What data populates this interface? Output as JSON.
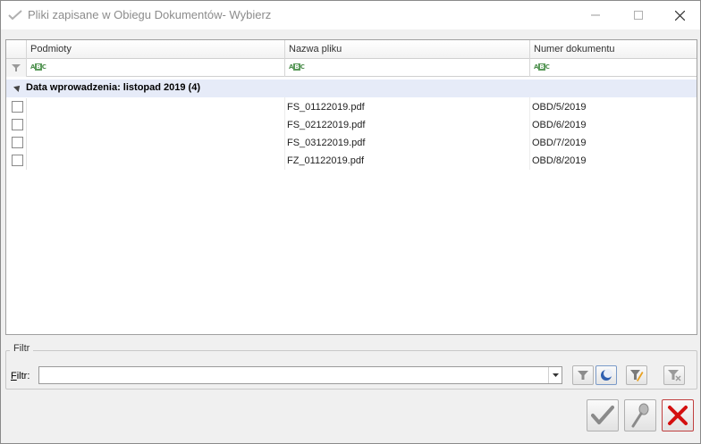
{
  "window": {
    "title": "Pliki zapisane w Obiegu Dokumentów- Wybierz"
  },
  "grid": {
    "columns": [
      "Podmioty",
      "Nazwa pliku",
      "Numer dokumentu"
    ],
    "filter_hint": "ABC",
    "group": {
      "label": "Data wprowadzenia: listopad 2019 (4)"
    },
    "rows": [
      {
        "podmioty": "",
        "nazwa": "FS_01122019.pdf",
        "numer": "OBD/5/2019"
      },
      {
        "podmioty": "",
        "nazwa": "FS_02122019.pdf",
        "numer": "OBD/6/2019"
      },
      {
        "podmioty": "",
        "nazwa": "FS_03122019.pdf",
        "numer": "OBD/7/2019"
      },
      {
        "podmioty": "",
        "nazwa": "FZ_01122019.pdf",
        "numer": "OBD/8/2019"
      }
    ]
  },
  "filter": {
    "group_title": "Filtr",
    "label_first": "F",
    "label_rest": "iltr:",
    "value": ""
  },
  "colors": {
    "group_bg": "#e6ebf8",
    "cancel_red": "#d41010",
    "accept_gray": "#8a8a8a"
  }
}
